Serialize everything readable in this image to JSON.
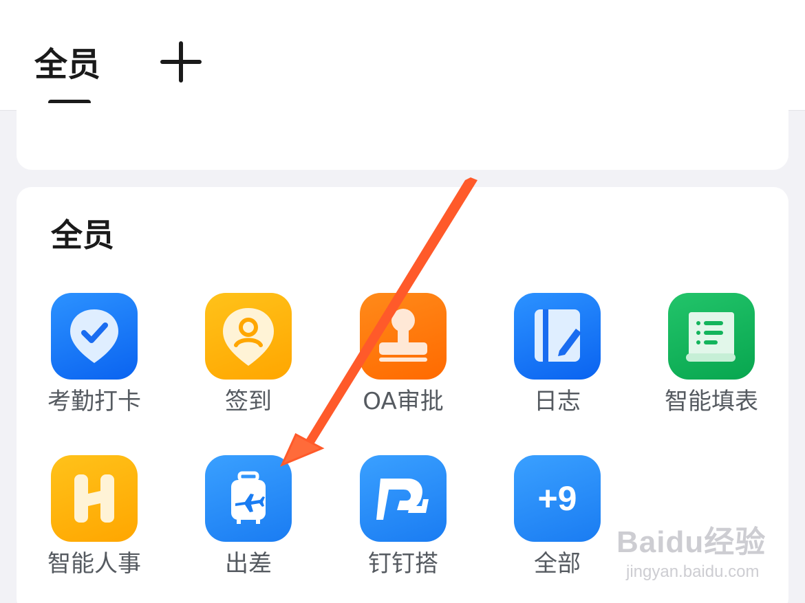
{
  "header": {
    "active_tab": "全员",
    "add_tab": "add"
  },
  "section": {
    "title": "全员"
  },
  "apps": [
    {
      "label": "考勤打卡",
      "icon": "location-check-icon",
      "color": "#1a78ff"
    },
    {
      "label": "签到",
      "icon": "location-person-icon",
      "color": "#ffb30d"
    },
    {
      "label": "OA审批",
      "icon": "stamp-icon",
      "color": "#ff7a0d"
    },
    {
      "label": "日志",
      "icon": "notebook-pen-icon",
      "color": "#1a78ff"
    },
    {
      "label": "智能填表",
      "icon": "scroll-list-icon",
      "color": "#14b45c"
    },
    {
      "label": "智能人事",
      "icon": "letter-h-icon",
      "color": "#ffb30d"
    },
    {
      "label": "出差",
      "icon": "luggage-plane-icon",
      "color": "#2a8cf8"
    },
    {
      "label": "钉钉搭",
      "icon": "dingtalk-build-icon",
      "color": "#1a88ff"
    },
    {
      "label": "全部",
      "icon_text": "+9",
      "color": "#1a88ff"
    }
  ],
  "watermark": {
    "logo": "Baidu经验",
    "url": "jingyan.baidu.com"
  },
  "colors": {
    "arrow": "#ff5a2a",
    "text_dark": "#1a1a1a",
    "label_gray": "#555a60"
  }
}
